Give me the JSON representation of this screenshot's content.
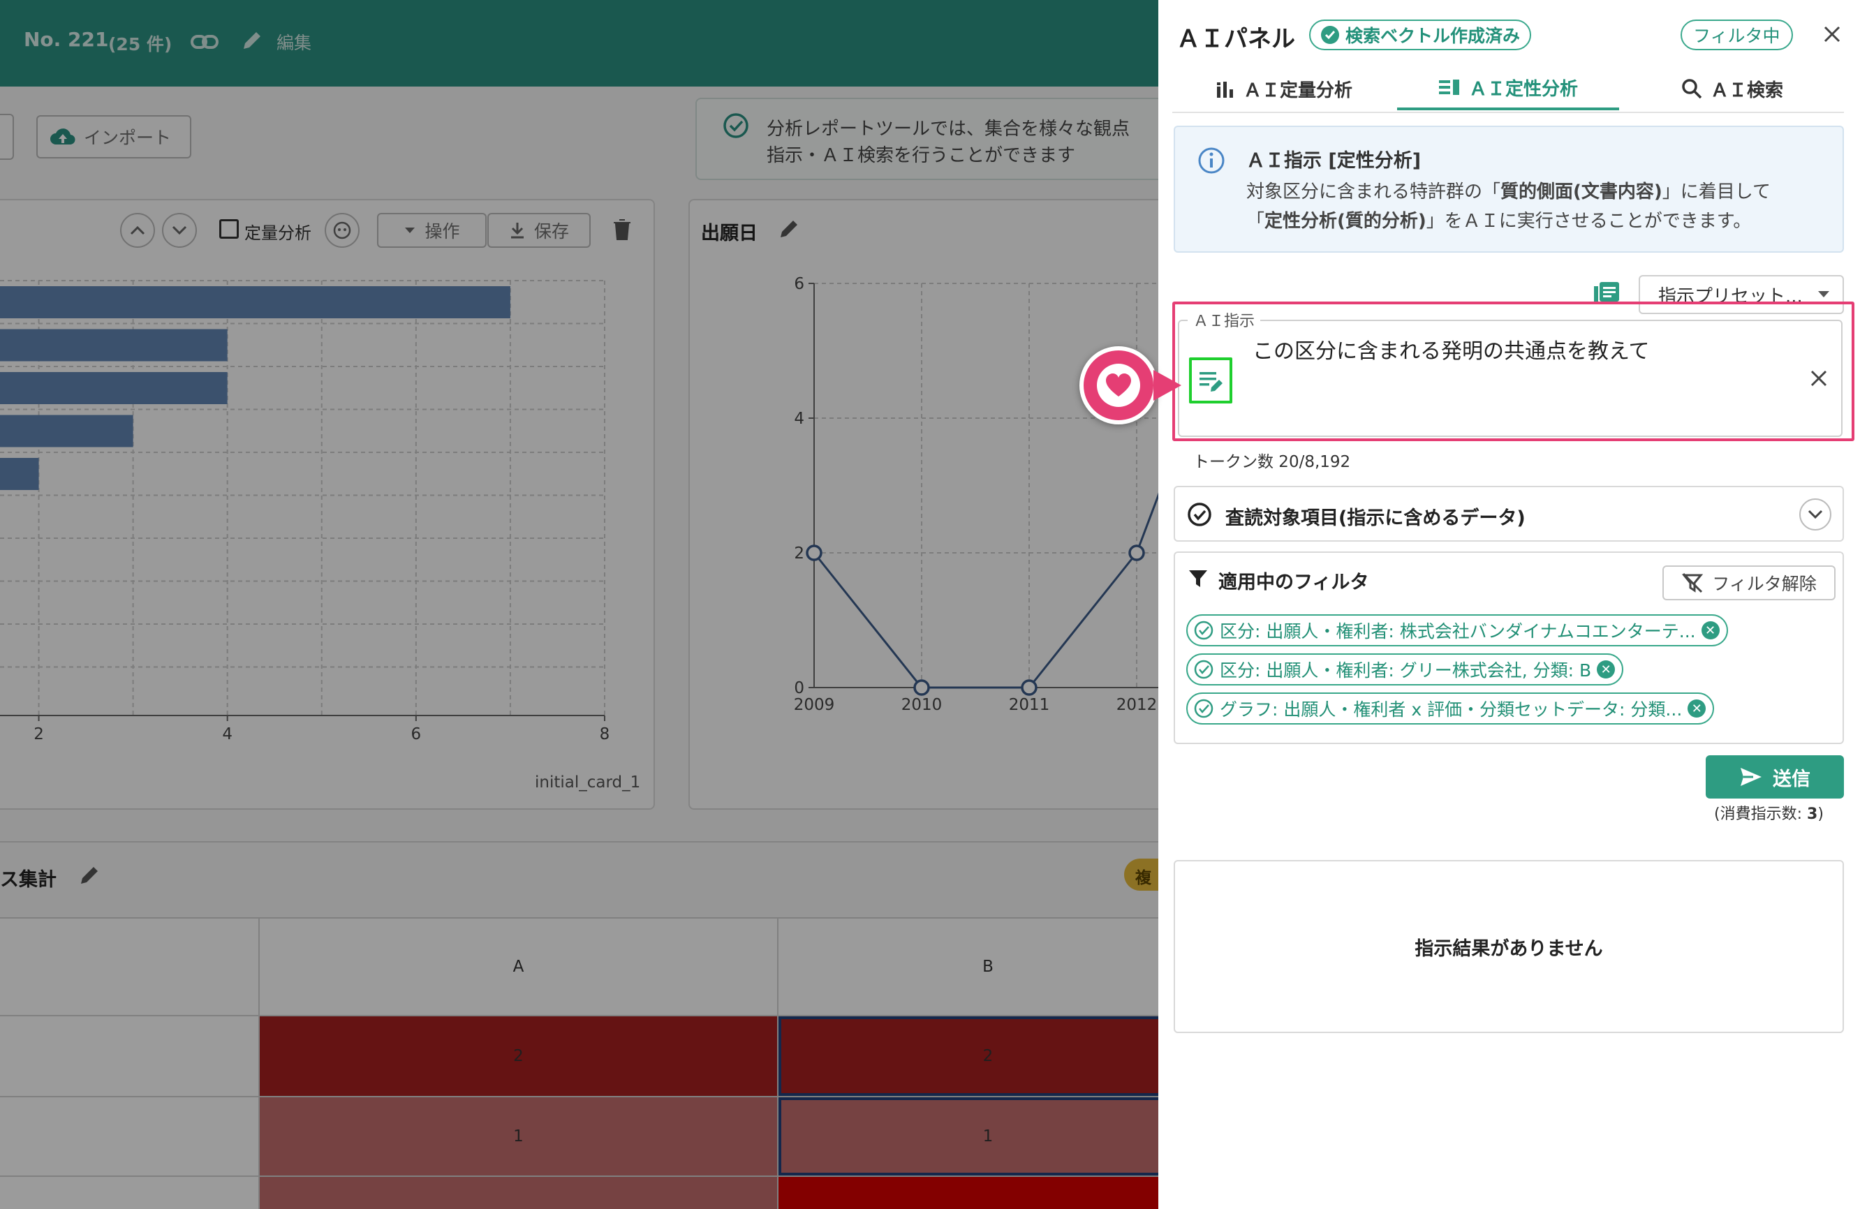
{
  "colors": {
    "header_teal": "#2a8f80",
    "accent_green": "#2e9c82",
    "highlight_pink": "#e53e74",
    "bar_blue": "#5f83b0",
    "cell_red_dark": "#a31f1f",
    "cell_red_light": "#bf6b6b"
  },
  "header": {
    "number": "No. 221",
    "count": "(25 件)",
    "edit_label": "編集"
  },
  "toolbar": {
    "import_label": "インポート"
  },
  "notice": {
    "line1": "分析レポートツールでは、集合を様々な観点",
    "line2": "指示・ＡＩ検索を行うことができます"
  },
  "card1": {
    "quant_label": "定量分析",
    "ops_label": "操作",
    "save_label": "保存",
    "footer": "initial_card_1"
  },
  "card2": {
    "title": "出願日"
  },
  "section2": {
    "title": "ス集計",
    "badge": "複"
  },
  "table": {
    "columns": [
      "A",
      "B"
    ],
    "rows": [
      [
        "2",
        "2"
      ],
      [
        "1",
        "1"
      ]
    ]
  },
  "chart_data": [
    {
      "type": "bar",
      "orientation": "horizontal",
      "values": [
        7,
        4,
        4,
        3,
        2
      ],
      "xlim": [
        1.5,
        8
      ],
      "x_ticks": [
        "2",
        "4",
        "6",
        "8"
      ],
      "grid": true
    },
    {
      "type": "line",
      "x": [
        "2009",
        "2010",
        "2011",
        "2012"
      ],
      "y": [
        2,
        0,
        0,
        2
      ],
      "y_ticks": [
        "0",
        "2",
        "4",
        "6"
      ],
      "ylim": [
        0,
        6
      ],
      "grid": true
    }
  ],
  "panel": {
    "title": "ＡＩパネル",
    "vector_chip": "検索ベクトル作成済み",
    "filter_chip": "フィルタ中",
    "tabs": [
      {
        "label": "ＡＩ定量分析",
        "icon": "bar-chart-icon"
      },
      {
        "label": "ＡＩ定性分析",
        "icon": "list-icon"
      },
      {
        "label": "ＡＩ検索",
        "icon": "search-icon"
      }
    ],
    "info": {
      "title": "ＡＩ指示 [定性分析]",
      "line1_pre": "対象区分に含まれる特許群の「",
      "line1_bold": "質的側面(文書内容)",
      "line1_post": "」に着目して",
      "line2_pre": "「",
      "line2_bold": "定性分析(質的分析)",
      "line2_post": "」をＡＩに実行させることができます。"
    },
    "preset_label": "指示プリセット...",
    "instruction_legend": "ＡＩ指示",
    "instruction_value": "この区分に含まれる発明の共通点を教えて",
    "token_count": "トークン数 20/8,192",
    "review_section": "査読対象項目(指示に含めるデータ)",
    "filter_section": "適用中のフィルタ",
    "filter_clear": "フィルタ解除",
    "filters": [
      "区分: 出願人・権利者: 株式会社バンダイナムコエンターテ...",
      "区分: 出願人・権利者: グリー株式会社, 分類: B",
      "グラフ: 出願人・権利者 x 評価・分類セットデータ: 分類..."
    ],
    "send_label": "送信",
    "consumption_pre": "(消費指示数: ",
    "consumption_value": "3",
    "consumption_post": ")",
    "empty_result": "指示結果がありません"
  }
}
